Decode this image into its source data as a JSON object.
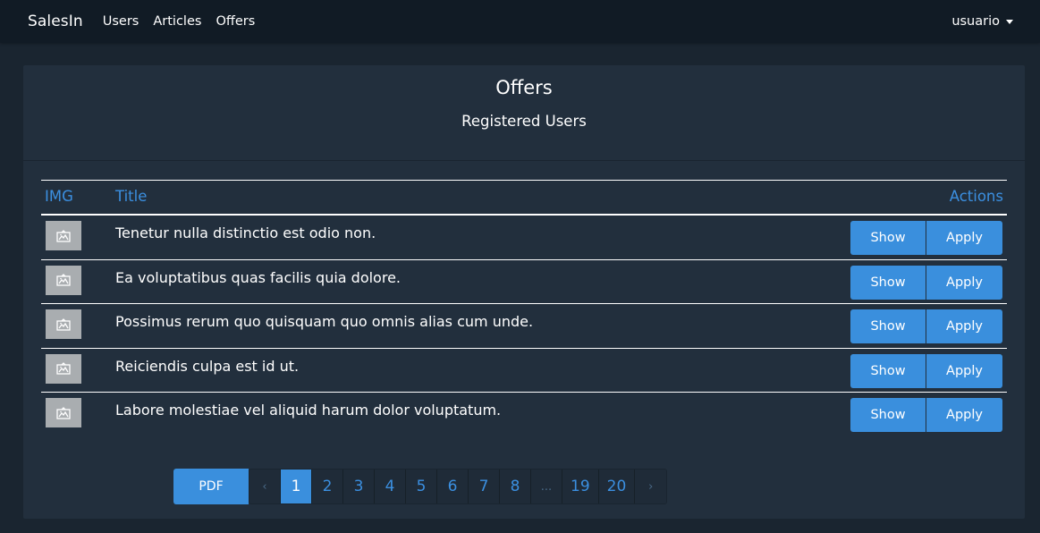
{
  "navbar": {
    "brand": "SalesIn",
    "links": [
      "Users",
      "Articles",
      "Offers"
    ],
    "user": "usuario"
  },
  "card": {
    "title": "Offers",
    "subtitle": "Registered Users"
  },
  "table": {
    "headers": {
      "img": "IMG",
      "title": "Title",
      "actions": "Actions"
    },
    "rows": [
      {
        "title": "Tenetur nulla distinctio est odio non.",
        "show": "Show",
        "apply": "Apply"
      },
      {
        "title": "Ea voluptatibus quas facilis quia dolore.",
        "show": "Show",
        "apply": "Apply"
      },
      {
        "title": "Possimus rerum quo quisquam quo omnis alias cum unde.",
        "show": "Show",
        "apply": "Apply"
      },
      {
        "title": "Reiciendis culpa est id ut.",
        "show": "Show",
        "apply": "Apply"
      },
      {
        "title": "Labore molestiae vel aliquid harum dolor voluptatum.",
        "show": "Show",
        "apply": "Apply"
      }
    ]
  },
  "pagination": {
    "pdf_label": "PDF",
    "prev": "‹",
    "pages": [
      "1",
      "2",
      "3",
      "4",
      "5",
      "6",
      "7",
      "8"
    ],
    "ellipsis": "...",
    "last_pages": [
      "19",
      "20"
    ],
    "next": "›",
    "current": "1"
  },
  "colors": {
    "accent": "#3a8fdd",
    "background": "#1a2530",
    "card": "#222f3d",
    "navbar": "#111b25"
  },
  "icons": {
    "thumbnail": "image-placeholder-icon",
    "user_menu": "caret-down-icon"
  }
}
